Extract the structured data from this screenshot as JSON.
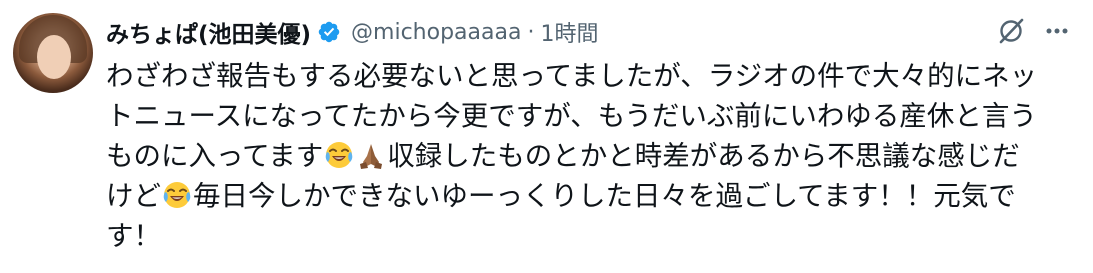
{
  "tweet": {
    "author": {
      "display_name": "みちょぱ(池田美優)",
      "handle": "@michopaaaaa",
      "verified": true,
      "avatar": "avatar"
    },
    "separator": "·",
    "time": "1時間",
    "text_lines": [
      "わざわざ報告もする必要ないと思ってましたが、ラジオの件で大々的にネッ",
      "トニュースになってたから今更ですが、もうだいぶ前にいわゆる産休と言う",
      [
        "ものに入ってます",
        "emoji:face-with-tears-of-joy",
        "emoji:folded-hands",
        "収録したものとかと時差があるから不思議な感じだ"
      ],
      [
        "けど",
        "emoji:face-with-tears-of-joy",
        "毎日今しかできないゆーっくりした日々を過ごしてます！！元気で"
      ],
      "す！"
    ],
    "line3_part1": "ものに入ってます",
    "line3_part2": "収録したものとかと時差があるから不思議な感じだ",
    "line4_part1": "けど",
    "line4_part2": "毎日今しかできないゆーっくりした日々を過ごしてます！！元気で"
  },
  "icons": {
    "verified": "verified-badge-icon",
    "grok": "grok-icon",
    "more": "more-options-icon"
  },
  "colors": {
    "text": "#0f1419",
    "secondary": "#536471",
    "verified_blue": "#1d9bf0",
    "background": "#ffffff"
  }
}
